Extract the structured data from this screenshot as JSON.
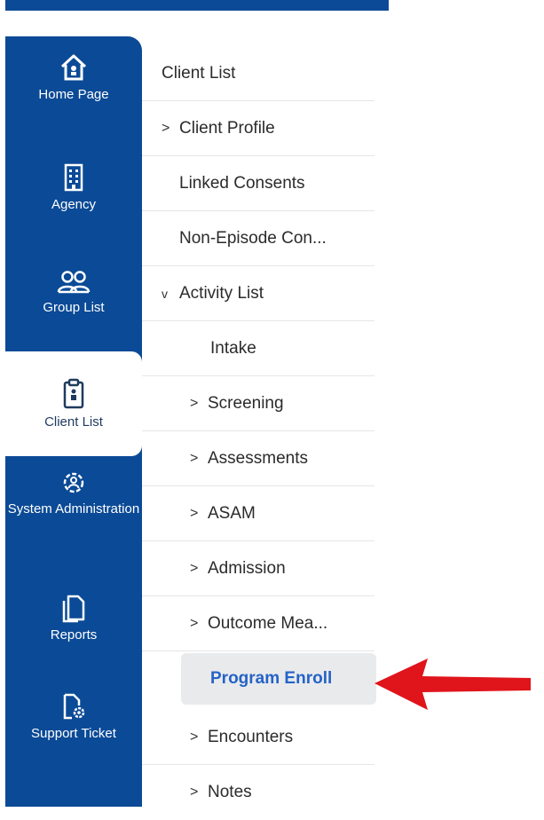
{
  "left_nav": {
    "items": [
      {
        "label": "Home Page",
        "icon": "home-icon",
        "active": false
      },
      {
        "label": "Agency",
        "icon": "building-icon",
        "active": false
      },
      {
        "label": "Group List",
        "icon": "group-icon",
        "active": false
      },
      {
        "label": "Client List",
        "icon": "clipboard-icon",
        "active": true
      },
      {
        "label": "System Administration",
        "icon": "settings-gear-icon",
        "active": false
      },
      {
        "label": "Reports",
        "icon": "document-copy-icon",
        "active": false
      },
      {
        "label": "Support Ticket",
        "icon": "ticket-gear-icon",
        "active": false
      }
    ]
  },
  "submenu": {
    "items": [
      {
        "label": "Client List",
        "chevron": ""
      },
      {
        "label": "Client Profile",
        "chevron": ">"
      },
      {
        "label": "Linked Consents",
        "chevron": ""
      },
      {
        "label": "Non-Episode Con...",
        "chevron": ""
      },
      {
        "label": "Activity List",
        "chevron": "v"
      },
      {
        "label": "Intake",
        "chevron": ""
      },
      {
        "label": "Screening",
        "chevron": ">"
      },
      {
        "label": "Assessments",
        "chevron": ">"
      },
      {
        "label": "ASAM",
        "chevron": ">"
      },
      {
        "label": "Admission",
        "chevron": ">"
      },
      {
        "label": "Outcome Mea...",
        "chevron": ">"
      },
      {
        "label": "Program Enroll",
        "chevron": ""
      },
      {
        "label": "Encounters",
        "chevron": ">"
      },
      {
        "label": "Notes",
        "chevron": ">"
      }
    ]
  },
  "colors": {
    "nav_blue": "#0b4a96",
    "highlight_text": "#2563c7",
    "arrow_red": "#e0141b"
  }
}
